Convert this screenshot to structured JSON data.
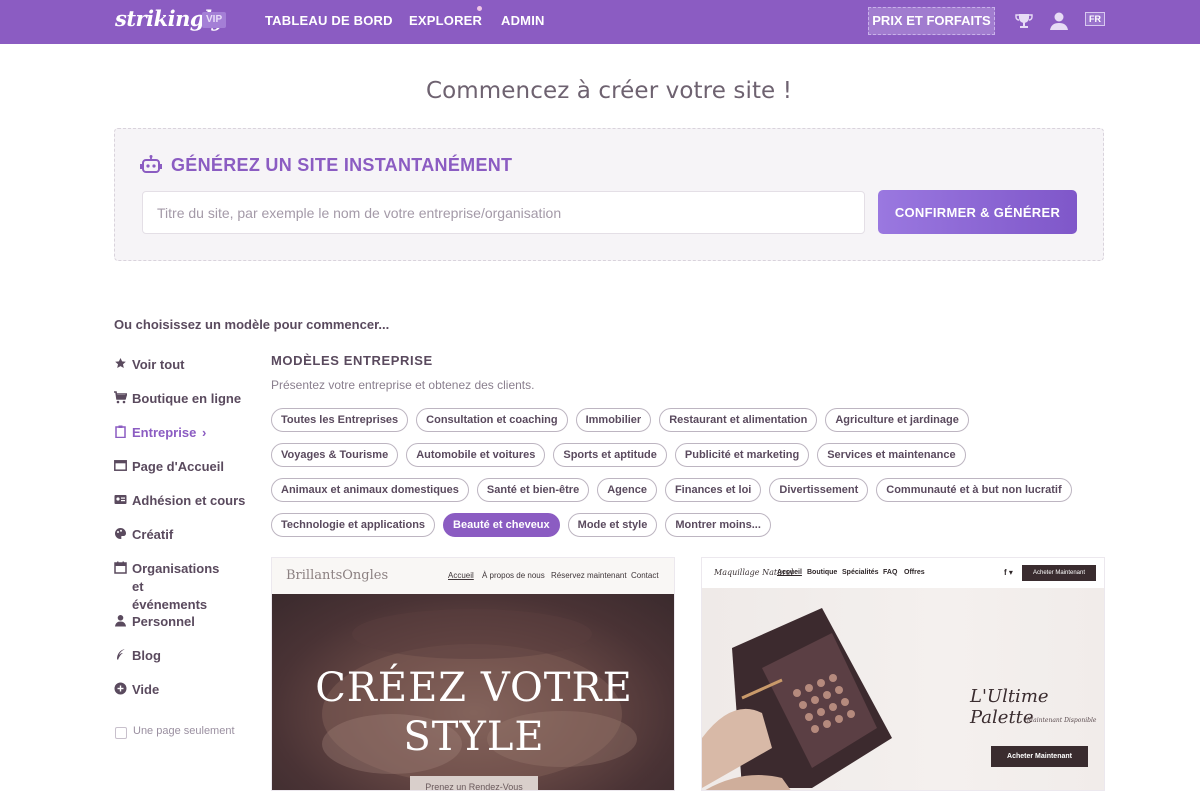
{
  "topnav": {
    "logo": "strikingly",
    "vip_badge": "VIP",
    "links": [
      "TABLEAU DE BORD",
      "EXPLORER",
      "ADMIN"
    ],
    "pricing_button": "PRIX ET FORFAITS",
    "icons": [
      "trophy-icon",
      "user-icon"
    ],
    "language": "FR",
    "background_color": "#8b5cc2"
  },
  "headline": "Commencez à créer votre site !",
  "generator": {
    "title": "GÉNÉREZ UN SITE INSTANTANÉMENT",
    "icon": "robot-icon",
    "input_value": "",
    "input_placeholder": "Titre du site, par exemple le nom de votre entreprise/organisation",
    "confirm_button": "CONFIRMER & GÉNÉRER"
  },
  "choose_label": "Ou choisissez un modèle pour commencer...",
  "sidebar": {
    "items": [
      {
        "label": "Voir tout",
        "icon": "star-icon"
      },
      {
        "label": "Boutique en ligne",
        "icon": "cart-icon"
      },
      {
        "label": "Entreprise",
        "icon": "clipboard-icon",
        "active": true,
        "chevron": "›"
      },
      {
        "label": "Page d'Accueil",
        "icon": "window-icon"
      },
      {
        "label": "Adhésion et cours",
        "icon": "id-card-icon"
      },
      {
        "label": "Créatif",
        "icon": "palette-icon"
      },
      {
        "label": "Organisations et\névénements",
        "icon": "calendar-icon"
      },
      {
        "label": "Personnel",
        "icon": "person-icon"
      },
      {
        "label": "Blog",
        "icon": "feather-icon"
      },
      {
        "label": "Vide",
        "icon": "plus-circle-icon"
      }
    ],
    "checkbox_label": "Une page seulement",
    "checkbox_checked": false
  },
  "category": {
    "title": "MODÈLES ENTREPRISE",
    "subtitle": "Présentez votre entreprise et obtenez des clients.",
    "tag_rows": [
      [
        "Toutes les Entreprises",
        "Consultation et coaching",
        "Immobilier",
        "Restaurant et alimentation",
        "Agriculture et jardinage"
      ],
      [
        "Voyages & Tourisme",
        "Automobile et voitures",
        "Sports et aptitude",
        "Publicité et marketing",
        "Services et maintenance"
      ],
      [
        "Animaux et animaux domestiques",
        "Santé et bien-être",
        "Agence",
        "Finances et loi",
        "Divertissement",
        "Communauté et à but non lucratif"
      ],
      [
        "Technologie et applications",
        "Beauté et cheveux",
        "Mode et style",
        "Montrer moins..."
      ]
    ],
    "selected_tag": "Beauté et cheveux"
  },
  "templates": [
    {
      "logo": "BrillantsOngles",
      "nav": [
        "Accueil",
        "À propos de nous",
        "Réservez maintenant",
        "Contact"
      ],
      "hero_line1": "CRÉEZ VOTRE",
      "hero_line2": "STYLE",
      "button": "Prenez un Rendez-Vous"
    },
    {
      "logo": "Maquillage Naturel",
      "nav": [
        "Accueil",
        "Boutique",
        "Spécialités",
        "FAQ",
        "Offres"
      ],
      "social": "f ▾",
      "nav_button": "Acheter Maintenant",
      "title": "L'Ultime Palette",
      "subtitle": "Maintenant Disponible",
      "button": "Acheter Maintenant"
    }
  ]
}
